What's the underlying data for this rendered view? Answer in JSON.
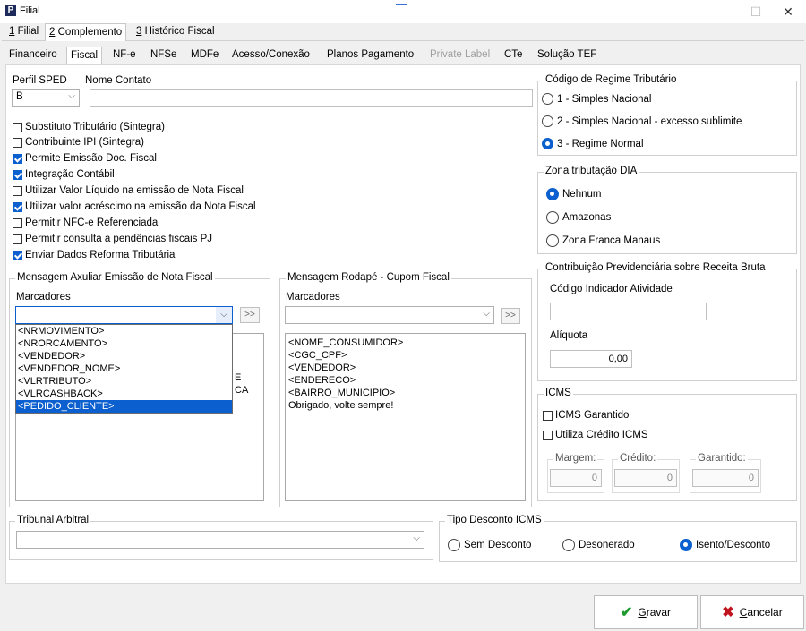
{
  "window": {
    "title": "Filial",
    "minimize": "—",
    "maximize": "☐",
    "close": "✕"
  },
  "top_tabs": [
    {
      "label": "1 Filial",
      "key": "1",
      "rest": " Filial"
    },
    {
      "label": "2 Complemento",
      "key": "2",
      "rest": " Complemento"
    },
    {
      "label": "3 Histórico Fiscal",
      "key": "3",
      "rest": " Histórico Fiscal"
    }
  ],
  "sub_tabs": [
    "Financeiro",
    "Fiscal",
    "NF-e",
    "NFSe",
    "MDFe",
    "Acesso/Conexão",
    "Planos Pagamento",
    "Private Label",
    "CTe",
    "Solução TEF"
  ],
  "perfil_sped": {
    "label": "Perfil SPED",
    "value": "B"
  },
  "nome_contato": {
    "label": "Nome Contato",
    "value": ""
  },
  "checkboxes": [
    {
      "label": "Substituto Tributário (Sintegra)",
      "checked": false
    },
    {
      "label": "Contribuinte IPI (Sintegra)",
      "checked": false
    },
    {
      "label": "Permite Emissão Doc. Fiscal",
      "checked": true
    },
    {
      "label": "Integração Contábil",
      "checked": true
    },
    {
      "label": "Utilizar Valor Líquido na emissão de Nota Fiscal",
      "checked": false
    },
    {
      "label": "Utilizar valor acréscimo na emissão da Nota Fiscal",
      "checked": true
    },
    {
      "label": "Permitir NFC-e Referenciada",
      "checked": false
    },
    {
      "label": "Permitir consulta a pendências fiscais PJ",
      "checked": false
    },
    {
      "label": "Enviar Dados Reforma Tributária",
      "checked": true
    }
  ],
  "regime": {
    "title": "Código de Regime Tributário",
    "options": [
      "1 - Simples Nacional",
      "2 - Simples Nacional - excesso sublimite",
      "3 - Regime Normal"
    ],
    "selected": 2
  },
  "zona": {
    "title": "Zona tributação DIA",
    "options": [
      "Nehnum",
      "Amazonas",
      "Zona Franca Manaus"
    ],
    "selected": 0
  },
  "contrib": {
    "title": "Contribuição Previdenciária sobre Receita Bruta",
    "codigo_label": "Código Indicador Atividade",
    "codigo_value": "",
    "aliquota_label": "Alíquota",
    "aliquota_value": "0,00"
  },
  "icms": {
    "title": "ICMS",
    "garantido_label": "ICMS Garantido",
    "credito_label": "Utiliza Crédito ICMS",
    "margem_label": "Margem:",
    "margem_value": "0",
    "credito_field_label": "Crédito:",
    "credito_value": "0",
    "garantido_field_label": "Garantido:",
    "garantido_value": "0"
  },
  "msg_aux": {
    "title": "Mensagem Axuliar Emissão de Nota Fiscal",
    "marcadores_label": "Marcadores",
    "combo_value": "|",
    "add_btn": ">>",
    "dropdown_items": [
      "<NRMOVIMENTO>",
      "<NRORCAMENTO>",
      "<VENDEDOR>",
      "<VENDEDOR_NOME>",
      "<VLRTRIBUTO>",
      "<VLRCASHBACK>",
      "<PEDIDO_CLIENTE>"
    ],
    "dropdown_selected": 6,
    "text_peek_1": "E",
    "text_peek_2": "CA"
  },
  "msg_rodape": {
    "title": "Mensagem Rodapé - Cupom Fiscal",
    "marcadores_label": "Marcadores",
    "combo_value": "",
    "add_btn": ">>",
    "text_lines": [
      "<NOME_CONSUMIDOR>",
      "<CGC_CPF>",
      "<VENDEDOR>",
      "<ENDERECO>",
      "<BAIRRO_MUNICIPIO>",
      "Obrigado, volte sempre!"
    ]
  },
  "tribunal": {
    "title": "Tribunal Arbitral",
    "value": ""
  },
  "tipo_desconto": {
    "title": "Tipo Desconto ICMS",
    "options": [
      "Sem Desconto",
      "Desonerado",
      "Isento/Desconto"
    ],
    "selected": 2
  },
  "buttons": {
    "gravar": "Gravar",
    "gravar_key": "G",
    "gravar_rest": "ravar",
    "cancelar": "Cancelar",
    "cancelar_key": "C",
    "cancelar_rest": "ancelar"
  },
  "colors": {
    "accent": "#0c5fce",
    "ok_green": "#1e9b2e",
    "cancel_red": "#c0141e"
  }
}
